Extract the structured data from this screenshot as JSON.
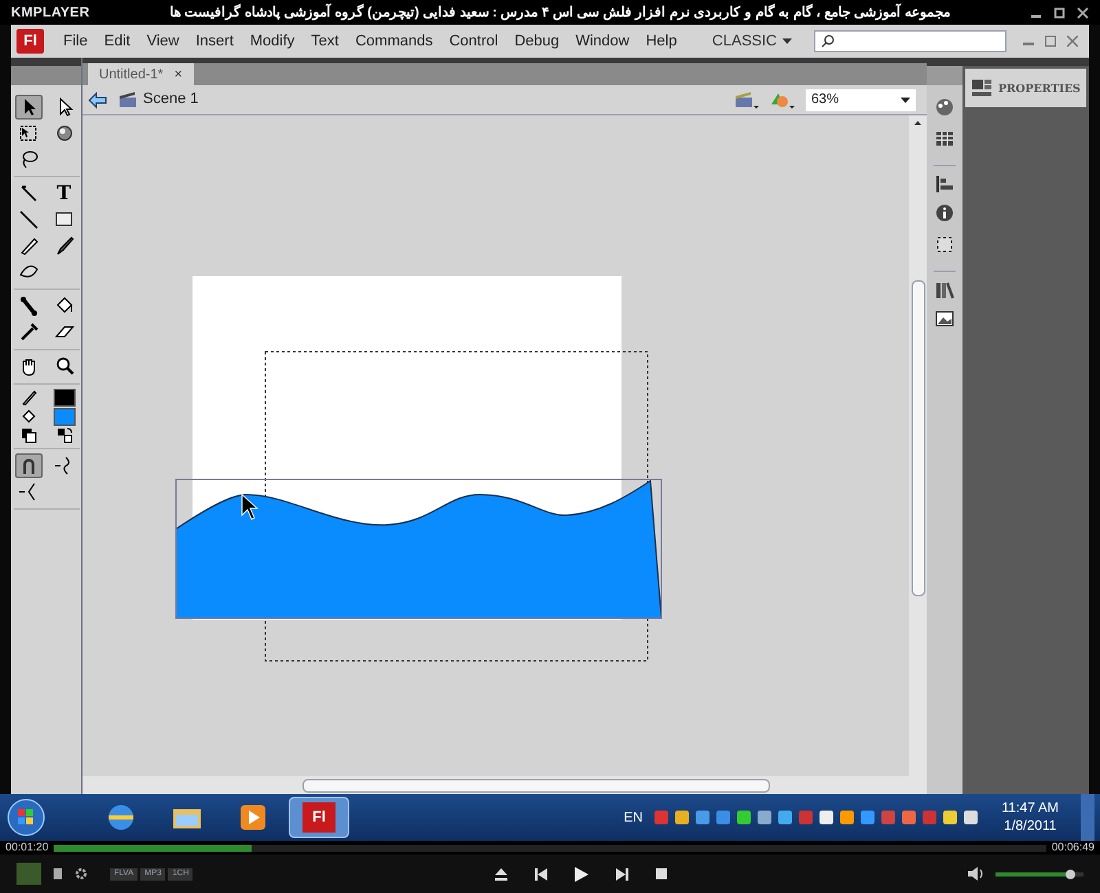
{
  "player": {
    "logo": "KMPLAYER",
    "title": "مجموعه آموزشی جامع ، گام به گام و کاربردی نرم افزار فلش سی اس ۴ مدرس : سعید فدایی (تیچرمن) گروه آموزشی پادشاه گرافیست ها",
    "elapsed": "00:01:20",
    "total": "00:06:49",
    "progress": {
      "level": 0.2
    },
    "volume": {
      "level": 0.8
    },
    "format_badges": [
      "FLVA",
      "MP3",
      "1CH"
    ]
  },
  "flash": {
    "logo": "Fl",
    "menu": [
      "File",
      "Edit",
      "View",
      "Insert",
      "Modify",
      "Text",
      "Commands",
      "Control",
      "Debug",
      "Window",
      "Help"
    ],
    "workspace": "CLASSIC",
    "tab": {
      "label": "Untitled-1*",
      "close": "×"
    },
    "scene": "Scene 1",
    "zoom": "63%",
    "tool_groups": [
      [
        {
          "kind": "selection",
          "selected": true
        },
        {
          "kind": "subselection",
          "selected": false
        },
        {
          "kind": "free-transform",
          "selected": false
        },
        {
          "kind": "rotate-3d",
          "selected": false
        },
        {
          "kind": "lasso",
          "selected": false
        }
      ],
      [
        {
          "kind": "pen",
          "selected": false
        },
        {
          "kind": "text",
          "glyph": "T",
          "selected": false
        },
        {
          "kind": "line",
          "selected": false
        },
        {
          "kind": "rectangle",
          "selected": false
        },
        {
          "kind": "pencil",
          "selected": false
        },
        {
          "kind": "brush",
          "selected": false
        },
        {
          "kind": "deco",
          "selected": false
        }
      ],
      [
        {
          "kind": "bone",
          "selected": false
        },
        {
          "kind": "bucket",
          "selected": false
        },
        {
          "kind": "eyedropper",
          "selected": false
        },
        {
          "kind": "eraser",
          "selected": false
        }
      ],
      [
        {
          "kind": "hand",
          "selected": false
        },
        {
          "kind": "zoom",
          "selected": false
        }
      ]
    ],
    "swatches": [
      {
        "kind": "stroke",
        "color": "#000000"
      },
      {
        "kind": "fill",
        "color": "#0a8cff"
      }
    ],
    "options": [
      {
        "kind": "snap",
        "selected": true
      },
      {
        "kind": "smooth",
        "selected": false
      },
      {
        "kind": "straighten",
        "selected": false
      }
    ],
    "properties": "PROPERTIES"
  },
  "taskbar": {
    "apps": [
      {
        "kind": "browser",
        "selected": false
      },
      {
        "kind": "folder",
        "selected": false
      },
      {
        "kind": "media",
        "selected": false
      },
      {
        "kind": "flash",
        "label": "Fl",
        "selected": true
      }
    ],
    "language": "EN",
    "time": "11:47 AM",
    "date": "1/8/2011"
  }
}
